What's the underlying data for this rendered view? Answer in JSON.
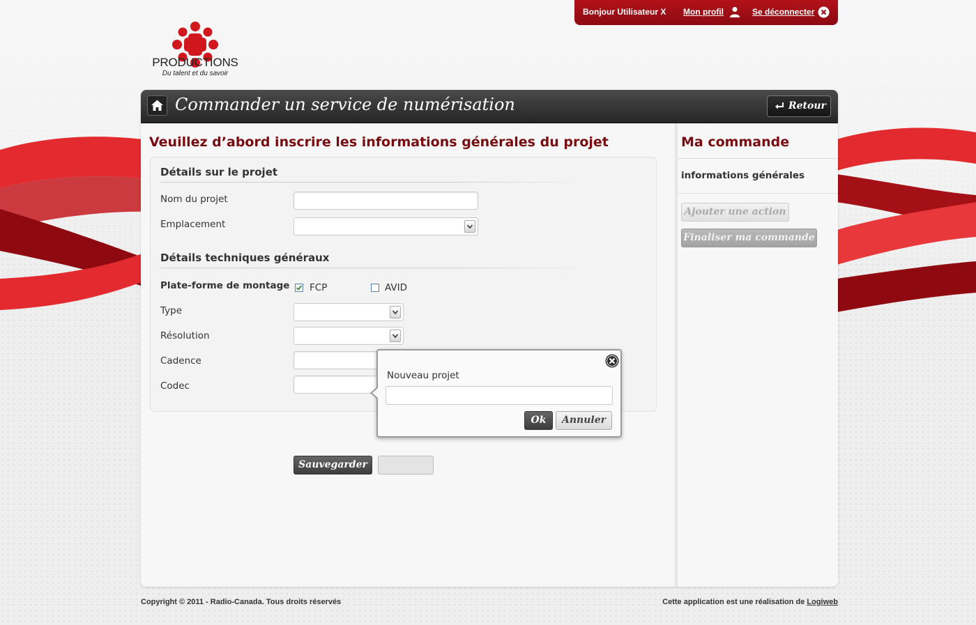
{
  "brand": {
    "name": "PRODUCTIONS",
    "tagline": "Du talent et du savoir"
  },
  "userbar": {
    "greeting": "Bonjour Utilisateur X",
    "profile_link": "Mon profil",
    "logout_link": "Se déconnecter"
  },
  "header": {
    "title": "Commander un service de numérisation",
    "back_button": "Retour"
  },
  "main": {
    "heading": "Veuillez d’abord inscrire les informations générales du projet",
    "section_project": {
      "title": "Détails sur le projet",
      "fields": {
        "project_name": {
          "label": "Nom du projet",
          "value": ""
        },
        "location": {
          "label": "Emplacement",
          "value": ""
        }
      }
    },
    "section_technical": {
      "title": "Détails techniques généraux",
      "platform": {
        "label": "Plate-forme de montage",
        "options": [
          {
            "label": "FCP",
            "checked": true
          },
          {
            "label": "AVID",
            "checked": false
          }
        ]
      },
      "fields": {
        "type": {
          "label": "Type",
          "value": ""
        },
        "resolution": {
          "label": "Résolution",
          "value": ""
        },
        "cadence": {
          "label": "Cadence",
          "value": ""
        },
        "codec": {
          "label": "Codec",
          "value": ""
        }
      }
    },
    "save_button": "Sauvegarder"
  },
  "sidebar": {
    "heading": "Ma commande",
    "current_item": "informations générales",
    "add_action_button": "Ajouter une action",
    "finalize_button": "Finaliser ma commande"
  },
  "popup": {
    "label": "Nouveau projet",
    "input_value": "",
    "ok_button": "Ok",
    "cancel_button": "Annuler"
  },
  "footer": {
    "copyright": "Copyright © 2011 - Radio-Canada. Tous droits réservés",
    "credit_prefix": "Cette application est une réalisation de ",
    "credit_link": "Logiweb"
  },
  "colors": {
    "brand_red": "#b2121a",
    "heading_red": "#7a0b10",
    "titlebar_dark": "#2e2e2e"
  }
}
